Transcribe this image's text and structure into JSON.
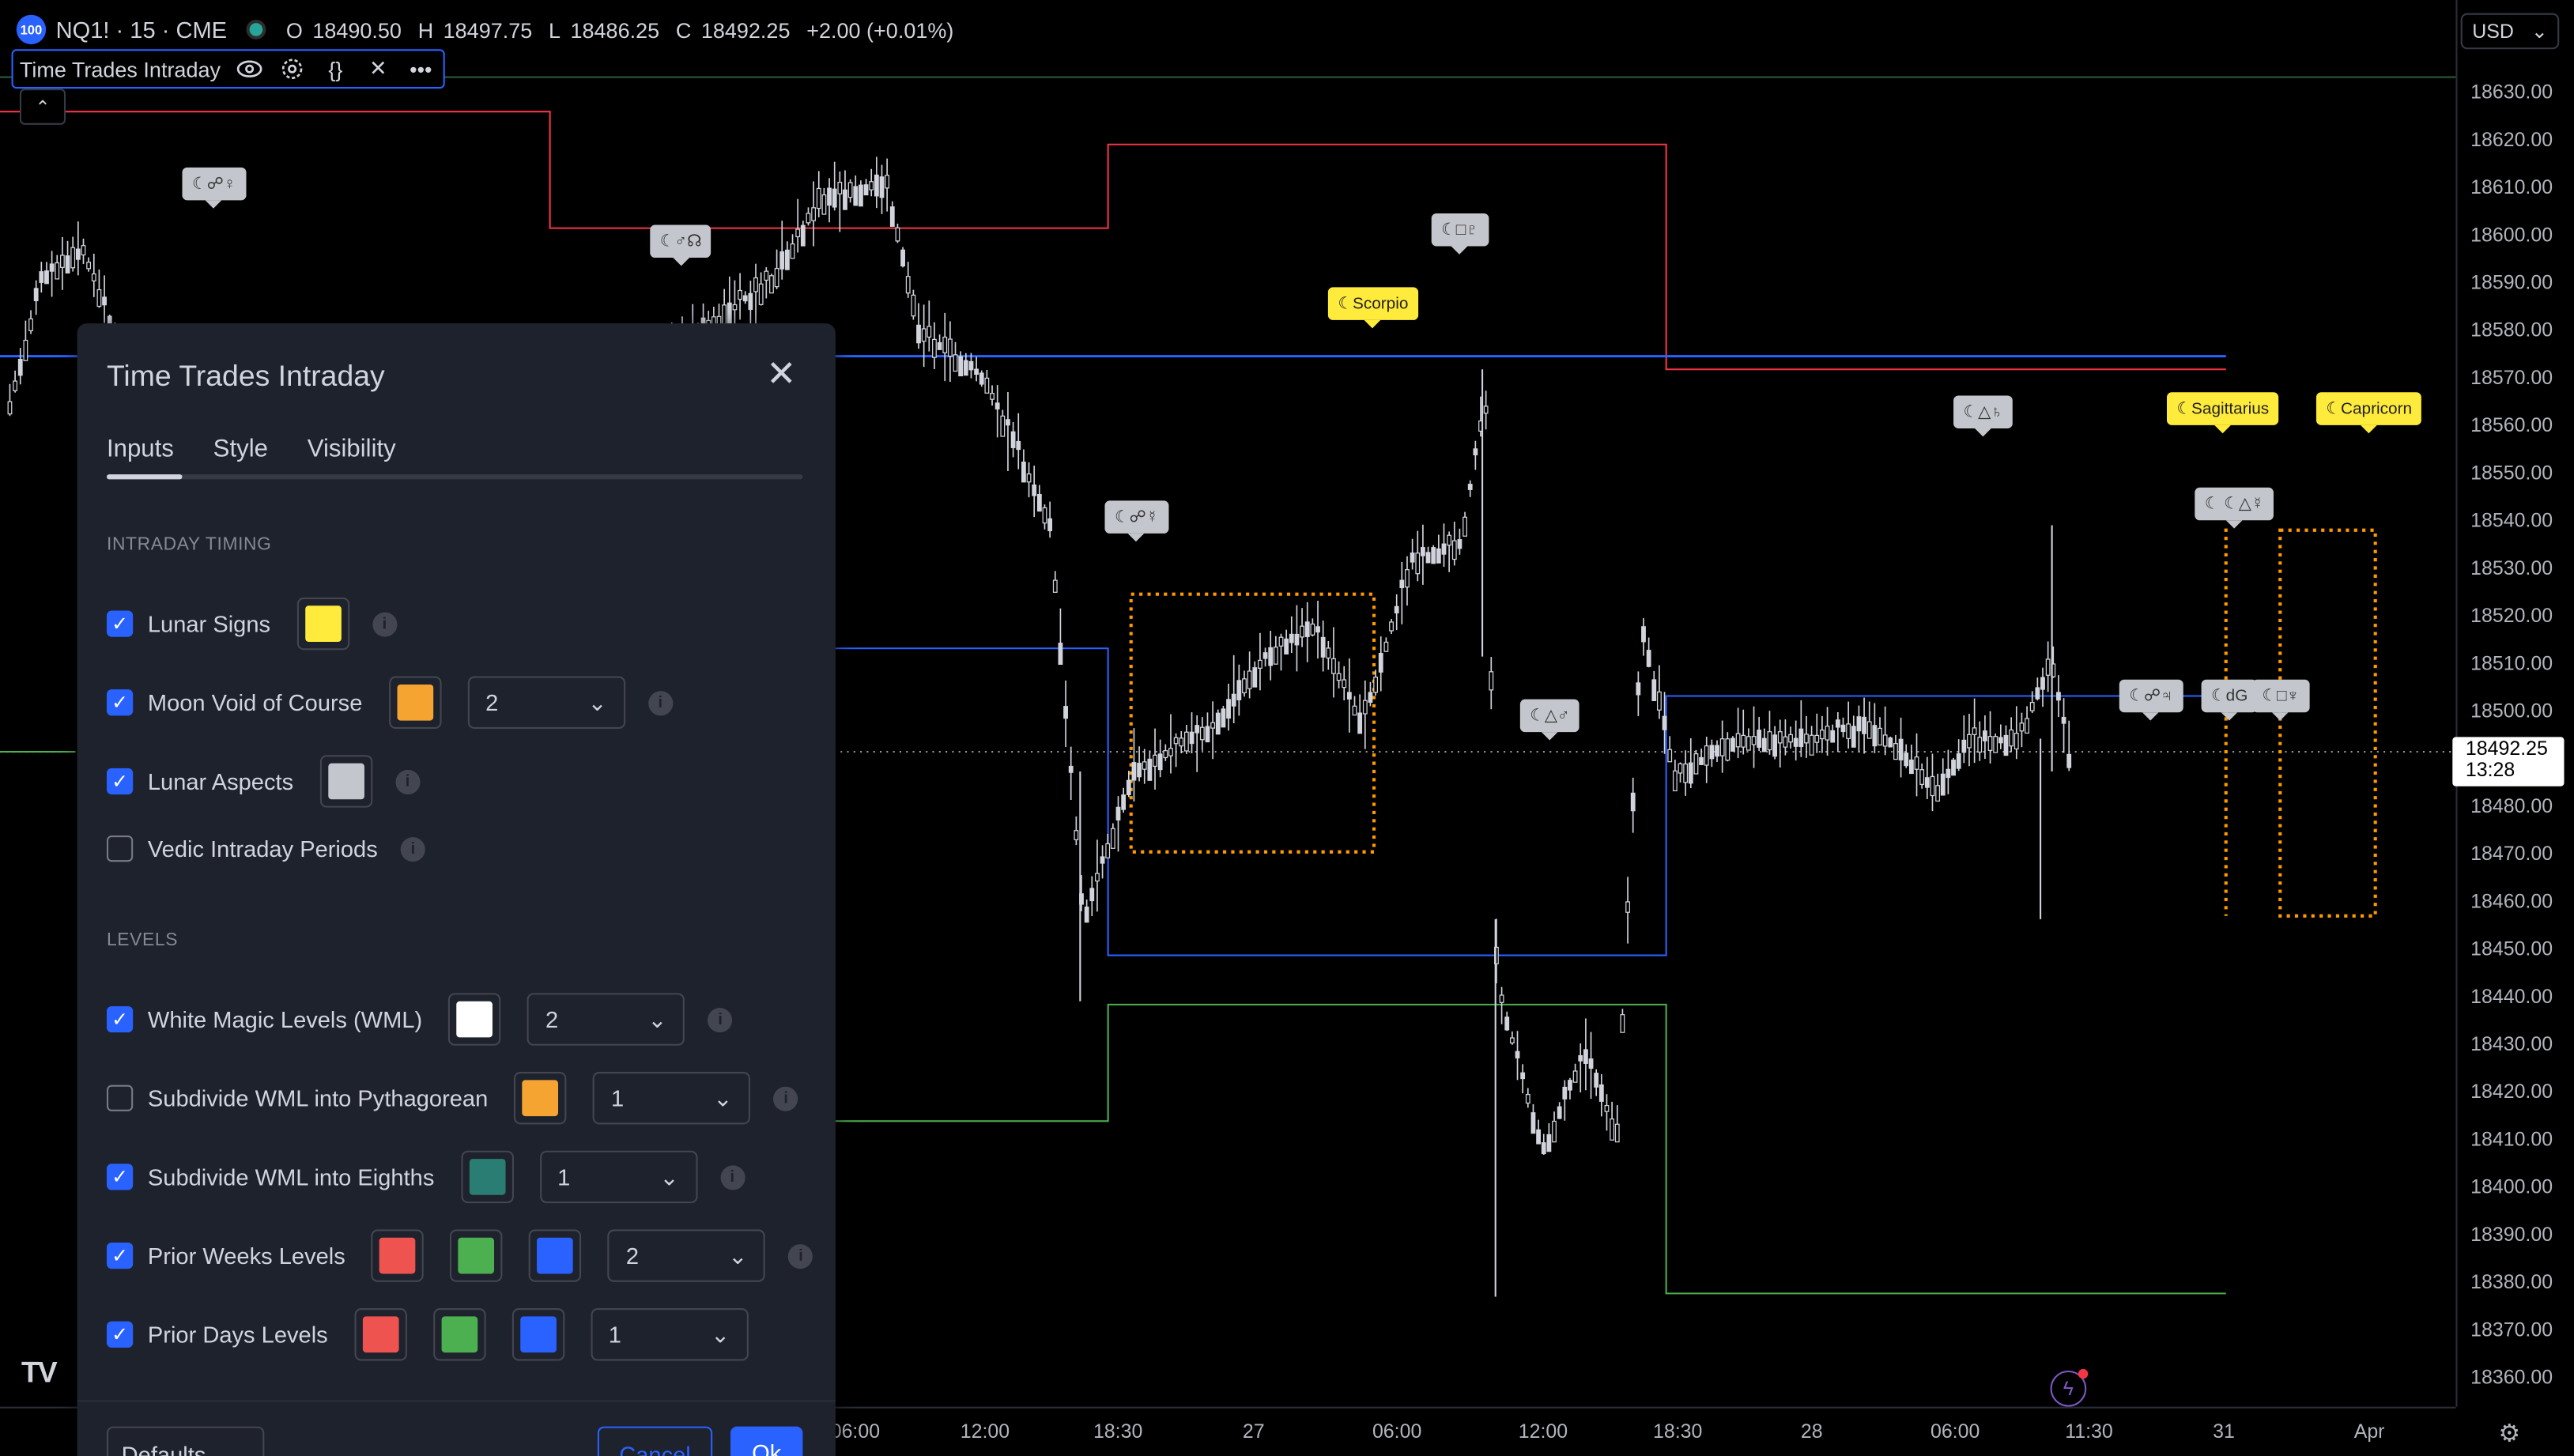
{
  "header": {
    "badge": "100",
    "symbol": "NQ1! · 15 · CME",
    "ohlc": [
      {
        "label": "O",
        "value": "18490.50"
      },
      {
        "label": "H",
        "value": "18497.75"
      },
      {
        "label": "L",
        "value": "18486.25"
      },
      {
        "label": "C",
        "value": "18492.25"
      }
    ],
    "change": "+2.00 (+0.01%)"
  },
  "indicator_bar": {
    "name": "Time Trades Intraday",
    "icons": [
      "eye-icon",
      "gear-icon",
      "braces-icon",
      "close-icon",
      "more-icon"
    ]
  },
  "currency_button": "USD",
  "price_axis": {
    "ticks": [
      "18630.00",
      "18620.00",
      "18610.00",
      "18600.00",
      "18590.00",
      "18580.00",
      "18570.00",
      "18560.00",
      "18550.00",
      "18540.00",
      "18530.00",
      "18520.00",
      "18510.00",
      "18500.00",
      "18480.00",
      "18470.00",
      "18460.00",
      "18450.00",
      "18440.00",
      "18430.00",
      "18420.00",
      "18410.00",
      "18400.00",
      "18390.00",
      "18380.00",
      "18370.00",
      "18360.00"
    ],
    "current_price": "18492.25",
    "countdown": "13:28"
  },
  "time_axis": {
    "ticks": [
      "06:00",
      "12:00",
      "18:30",
      "27",
      "06:00",
      "12:00",
      "18:30",
      "28",
      "06:00",
      "11:30",
      "31",
      "Apr"
    ]
  },
  "logo": "TV",
  "chart_labels": {
    "gray": [
      "☾☍♀",
      "☾♂☊",
      "☾□♇",
      "☾☍☿",
      "☾△♂",
      "☾△♄",
      "☾ ☾△☿",
      "☾☍♃",
      "☾dG",
      "☾□♆"
    ],
    "yellow": [
      "☾Scorpio",
      "☾Sagittarius",
      "☾Capricorn"
    ]
  },
  "colors": {
    "bg": "#000000",
    "candle": "#d1d4dc",
    "red_level": "#f23645",
    "blue_level": "#2962ff",
    "green_level": "#4caf50",
    "orange_box": "#ff9800",
    "dialog_bg": "#1e222d",
    "accent": "#2962ff"
  },
  "dialog": {
    "title": "Time Trades Intraday",
    "tabs": [
      "Inputs",
      "Style",
      "Visibility"
    ],
    "active_tab": "Inputs",
    "sections": {
      "intraday": "INTRADAY TIMING",
      "levels": "LEVELS"
    },
    "rows": {
      "lunar_signs": {
        "label": "Lunar Signs",
        "checked": true,
        "color": "#ffeb3b"
      },
      "moon_void": {
        "label": "Moon Void of Course",
        "checked": true,
        "color": "#f5a431",
        "select": "2"
      },
      "lunar_aspects": {
        "label": "Lunar Aspects",
        "checked": true,
        "color": "#c3c6cc"
      },
      "vedic": {
        "label": "Vedic Intraday Periods",
        "checked": false
      },
      "wml": {
        "label": "White Magic Levels (WML)",
        "checked": true,
        "color": "#ffffff",
        "select": "2"
      },
      "pythagorean": {
        "label": "Subdivide WML into Pythagorean",
        "checked": false,
        "color": "#f5a431",
        "select": "1"
      },
      "eighths": {
        "label": "Subdivide WML into Eighths",
        "checked": true,
        "color": "#2a7d73",
        "select": "1"
      },
      "prior_weeks": {
        "label": "Prior Weeks Levels",
        "checked": true,
        "colors": [
          "#ef5350",
          "#4caf50",
          "#2962ff"
        ],
        "select": "2"
      },
      "prior_days": {
        "label": "Prior Days Levels",
        "checked": true,
        "colors": [
          "#ef5350",
          "#4caf50",
          "#2962ff"
        ],
        "select": "1"
      }
    },
    "footer": {
      "defaults": "Defaults",
      "cancel": "Cancel",
      "ok": "Ok"
    }
  }
}
